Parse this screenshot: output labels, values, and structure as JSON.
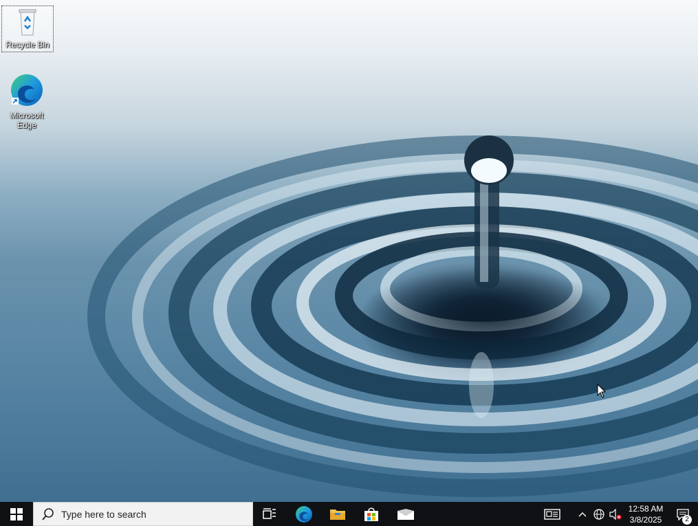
{
  "desktop": {
    "icons": [
      {
        "label": "Recycle Bin",
        "icon": "recycle-bin-icon"
      },
      {
        "label": "Microsoft\nEdge",
        "icon": "edge-icon"
      }
    ]
  },
  "taskbar": {
    "start_icon": "windows-logo-icon",
    "search_placeholder": "Type here to search",
    "pinned": [
      {
        "name": "task-view",
        "icon": "task-view-icon"
      },
      {
        "name": "edge",
        "icon": "edge-icon"
      },
      {
        "name": "file-explorer",
        "icon": "folder-icon"
      },
      {
        "name": "microsoft-store",
        "icon": "store-icon"
      },
      {
        "name": "mail",
        "icon": "mail-icon"
      }
    ],
    "tray": {
      "time": "12:58 AM",
      "date": "3/8/2025",
      "notification_count": "2"
    }
  },
  "colors": {
    "taskbar_bg": "#0f1114",
    "search_bg": "#f2f2f2"
  }
}
